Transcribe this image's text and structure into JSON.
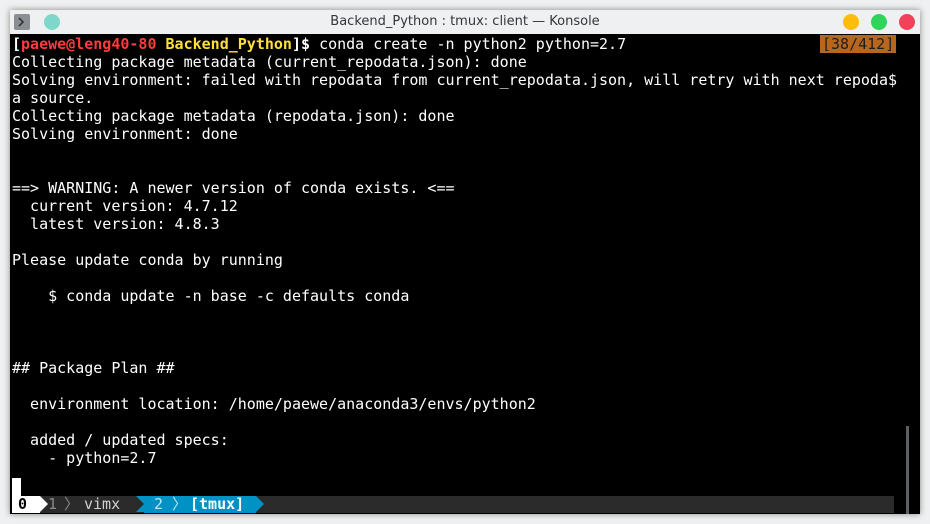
{
  "window": {
    "title": "Backend_Python : tmux: client — Konsole"
  },
  "prompt": {
    "open_bracket": "[",
    "user_host": "paewe@leng40-80",
    "cwd": "Backend_Python",
    "close": "]$ ",
    "command": "conda create -n python2 python=2.7"
  },
  "scroll_position": "[38/412]",
  "output_lines": [
    "Collecting package metadata (current_repodata.json): done",
    "Solving environment: failed with repodata from current_repodata.json, will retry with next repoda$",
    "a source.",
    "Collecting package metadata (repodata.json): done",
    "Solving environment: done",
    "",
    "",
    "==> WARNING: A newer version of conda exists. <==",
    "  current version: 4.7.12",
    "  latest version: 4.8.3",
    "",
    "Please update conda by running",
    "",
    "    $ conda update -n base -c defaults conda",
    "",
    "",
    "",
    "## Package Plan ##",
    "",
    "  environment location: /home/paewe/anaconda3/envs/python2",
    "",
    "  added / updated specs:",
    "    - python=2.7"
  ],
  "tmux": {
    "windows": [
      {
        "index": "0",
        "name": ""
      },
      {
        "index": "1",
        "name": "vimx"
      },
      {
        "index": "2",
        "name": "[tmux]"
      }
    ],
    "separator": "〉"
  },
  "colors": {
    "terminal_bg": "#000000",
    "user_host": "#ff3b3b",
    "cwd": "#ffe03a",
    "position_badge": "#b8661e",
    "active_window": "#0092c4"
  }
}
